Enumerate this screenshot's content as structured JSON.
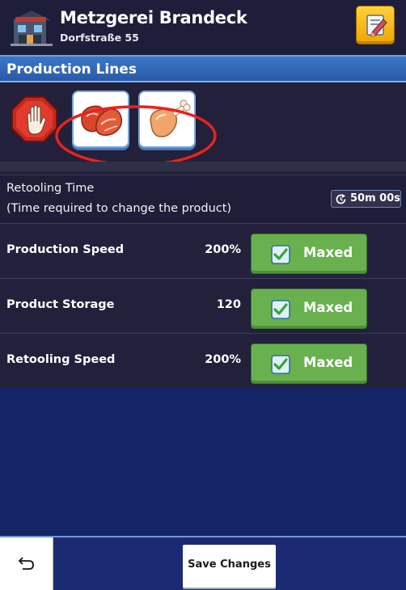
{
  "header": {
    "title": "Metzgerei Brandeck",
    "address": "Dorfstraße 55",
    "building_icon": "shop-building-icon",
    "edit_icon": "pencil-edit-icon"
  },
  "production": {
    "section_title": "Production Lines",
    "lines": [
      {
        "icon": "stop-hand-icon"
      },
      {
        "icon": "raw-steak-icon"
      },
      {
        "icon": "chicken-drumstick-icon"
      }
    ],
    "highlight_color": "#e8231d"
  },
  "retooling": {
    "line1": "Retooling Time",
    "line2": "(Time required to change the product)",
    "timer": "50m 00s",
    "timer_icon": "refresh-timer-icon"
  },
  "stats": [
    {
      "label": "Production Speed",
      "value": "200%",
      "button": "Maxed"
    },
    {
      "label": "Product Storage",
      "value": "120",
      "button": "Maxed"
    },
    {
      "label": "Retooling Speed",
      "value": "200%",
      "button": "Maxed"
    }
  ],
  "footer": {
    "back_icon": "undo-arrow-icon",
    "save_label": "Save Changes"
  },
  "colors": {
    "background": "#132467",
    "panel": "#22203b",
    "section_header": "#3c77c8",
    "maxed_green": "#69b04f",
    "edit_button": "#ffc92a"
  }
}
